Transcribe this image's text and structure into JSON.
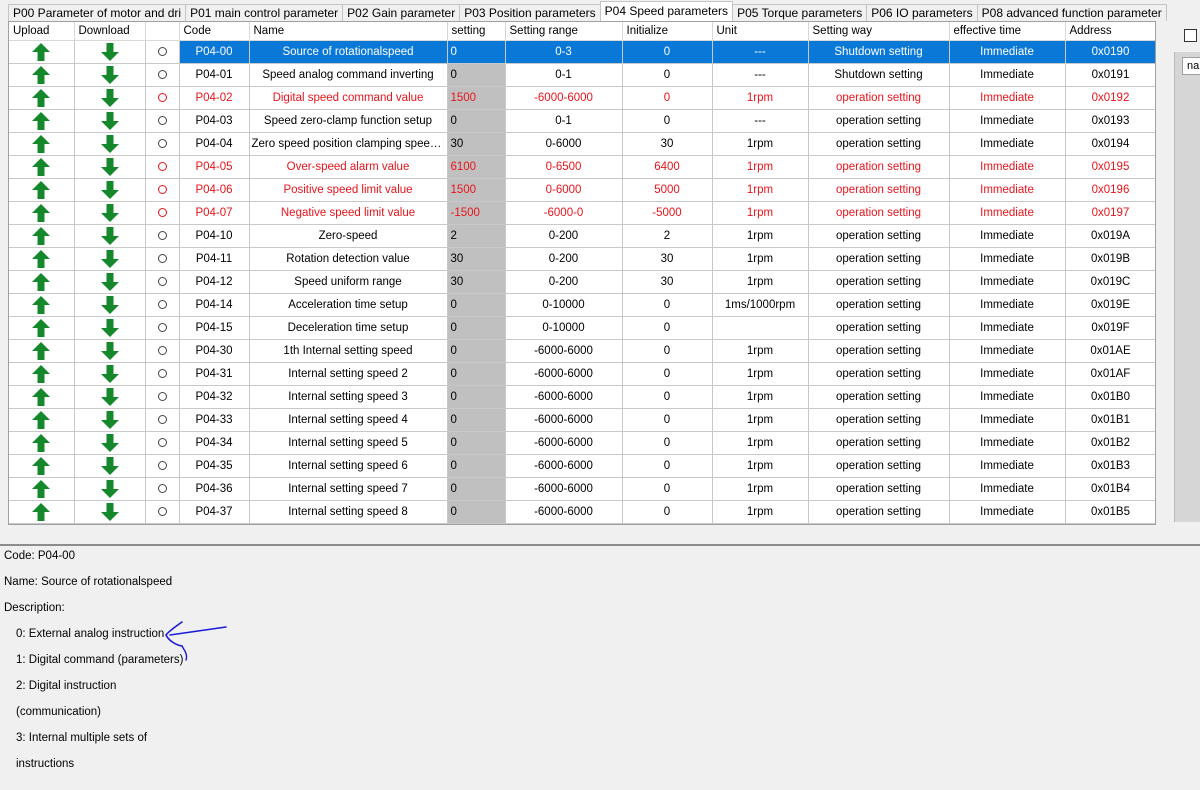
{
  "tabs": [
    {
      "label": "P00  Parameter of motor and dri",
      "active": false
    },
    {
      "label": "P01 main control parameter",
      "active": false
    },
    {
      "label": "P02 Gain parameter",
      "active": false
    },
    {
      "label": "P03 Position parameters",
      "active": false
    },
    {
      "label": "P04 Speed parameters",
      "active": true
    },
    {
      "label": "P05 Torque parameters",
      "active": false
    },
    {
      "label": "P06 IO parameters",
      "active": false
    },
    {
      "label": "P08 advanced function parameter",
      "active": false
    }
  ],
  "columns": [
    "Upload",
    "Download",
    "",
    "Code",
    "Name",
    "setting",
    "Setting range",
    "Initialize",
    "Unit",
    "Setting way",
    "effective time",
    "Address"
  ],
  "rows": [
    {
      "code": "P04-00",
      "name": "Source of rotationalspeed",
      "setting": "0",
      "range": "0-3",
      "init": "0",
      "unit": "---",
      "way": "Shutdown setting",
      "time": "Immediate",
      "addr": "0x0190",
      "state": "selected"
    },
    {
      "code": "P04-01",
      "name": "Speed analog command inverting",
      "setting": "0",
      "range": "0-1",
      "init": "0",
      "unit": "---",
      "way": "Shutdown setting",
      "time": "Immediate",
      "addr": "0x0191",
      "state": "normal"
    },
    {
      "code": "P04-02",
      "name": "Digital speed command value",
      "setting": "1500",
      "range": "-6000-6000",
      "init": "0",
      "unit": "1rpm",
      "way": "operation setting",
      "time": "Immediate",
      "addr": "0x0192",
      "state": "modified"
    },
    {
      "code": "P04-03",
      "name": "Speed zero-clamp function setup",
      "setting": "0",
      "range": "0-1",
      "init": "0",
      "unit": "---",
      "way": "operation setting",
      "time": "Immediate",
      "addr": "0x0193",
      "state": "normal"
    },
    {
      "code": "P04-04",
      "name": "Zero speed position clamping speed threshold",
      "setting": "30",
      "range": "0-6000",
      "init": "30",
      "unit": "1rpm",
      "way": "operation setting",
      "time": "Immediate",
      "addr": "0x0194",
      "state": "normal"
    },
    {
      "code": "P04-05",
      "name": "Over-speed alarm value",
      "setting": "6100",
      "range": "0-6500",
      "init": "6400",
      "unit": "1rpm",
      "way": "operation setting",
      "time": "Immediate",
      "addr": "0x0195",
      "state": "modified"
    },
    {
      "code": "P04-06",
      "name": "Positive speed limit value",
      "setting": "1500",
      "range": "0-6000",
      "init": "5000",
      "unit": "1rpm",
      "way": "operation setting",
      "time": "Immediate",
      "addr": "0x0196",
      "state": "modified"
    },
    {
      "code": "P04-07",
      "name": "Negative speed limit value",
      "setting": "-1500",
      "range": "-6000-0",
      "init": "-5000",
      "unit": "1rpm",
      "way": "operation setting",
      "time": "Immediate",
      "addr": "0x0197",
      "state": "modified"
    },
    {
      "code": "P04-10",
      "name": "Zero-speed",
      "setting": "2",
      "range": "0-200",
      "init": "2",
      "unit": "1rpm",
      "way": "operation setting",
      "time": "Immediate",
      "addr": "0x019A",
      "state": "normal"
    },
    {
      "code": "P04-11",
      "name": "Rotation detection value",
      "setting": "30",
      "range": "0-200",
      "init": "30",
      "unit": "1rpm",
      "way": "operation setting",
      "time": "Immediate",
      "addr": "0x019B",
      "state": "normal"
    },
    {
      "code": "P04-12",
      "name": "Speed uniform range",
      "setting": "30",
      "range": "0-200",
      "init": "30",
      "unit": "1rpm",
      "way": "operation setting",
      "time": "Immediate",
      "addr": "0x019C",
      "state": "normal"
    },
    {
      "code": "P04-14",
      "name": "Acceleration time setup",
      "setting": "0",
      "range": "0-10000",
      "init": "0",
      "unit": "1ms/1000rpm",
      "way": "operation setting",
      "time": "Immediate",
      "addr": "0x019E",
      "state": "normal"
    },
    {
      "code": "P04-15",
      "name": "Deceleration time setup",
      "setting": "0",
      "range": "0-10000",
      "init": "0",
      "unit": "",
      "way": "operation setting",
      "time": "Immediate",
      "addr": "0x019F",
      "state": "normal"
    },
    {
      "code": "P04-30",
      "name": "1th Internal setting speed",
      "setting": "0",
      "range": "-6000-6000",
      "init": "0",
      "unit": "1rpm",
      "way": "operation setting",
      "time": "Immediate",
      "addr": "0x01AE",
      "state": "normal"
    },
    {
      "code": "P04-31",
      "name": "Internal setting speed 2",
      "setting": "0",
      "range": "-6000-6000",
      "init": "0",
      "unit": "1rpm",
      "way": "operation setting",
      "time": "Immediate",
      "addr": "0x01AF",
      "state": "normal"
    },
    {
      "code": "P04-32",
      "name": "Internal setting speed 3",
      "setting": "0",
      "range": "-6000-6000",
      "init": "0",
      "unit": "1rpm",
      "way": "operation setting",
      "time": "Immediate",
      "addr": "0x01B0",
      "state": "normal"
    },
    {
      "code": "P04-33",
      "name": "Internal setting speed 4",
      "setting": "0",
      "range": "-6000-6000",
      "init": "0",
      "unit": "1rpm",
      "way": "operation setting",
      "time": "Immediate",
      "addr": "0x01B1",
      "state": "normal"
    },
    {
      "code": "P04-34",
      "name": "Internal setting speed 5",
      "setting": "0",
      "range": "-6000-6000",
      "init": "0",
      "unit": "1rpm",
      "way": "operation setting",
      "time": "Immediate",
      "addr": "0x01B2",
      "state": "normal"
    },
    {
      "code": "P04-35",
      "name": "Internal setting speed 6",
      "setting": "0",
      "range": "-6000-6000",
      "init": "0",
      "unit": "1rpm",
      "way": "operation setting",
      "time": "Immediate",
      "addr": "0x01B3",
      "state": "normal"
    },
    {
      "code": "P04-36",
      "name": "Internal setting speed 7",
      "setting": "0",
      "range": "-6000-6000",
      "init": "0",
      "unit": "1rpm",
      "way": "operation setting",
      "time": "Immediate",
      "addr": "0x01B4",
      "state": "normal"
    },
    {
      "code": "P04-37",
      "name": "Internal setting speed 8",
      "setting": "0",
      "range": "-6000-6000",
      "init": "0",
      "unit": "1rpm",
      "way": "operation setting",
      "time": "Immediate",
      "addr": "0x01B5",
      "state": "normal"
    }
  ],
  "colors": {
    "upload_arrow": "#15882b",
    "download_arrow": "#15882b",
    "selected_row": "#0a78d7",
    "modified_text": "#e8141c",
    "setting_cell": "#c0c0c0",
    "annotation": "#1a1ad8"
  },
  "icons": {
    "upload": "up-arrow-icon",
    "download": "down-arrow-icon",
    "select": "radio-circle-icon"
  },
  "right_panel": {
    "input_text": "na"
  },
  "description": {
    "code_line": "Code: P04-00",
    "name_line": "Name: Source of rotationalspeed",
    "desc_label": "Description:",
    "lines": [
      "0: External analog instruction",
      "1: Digital command (parameters)",
      "2: Digital instruction",
      "(communication)",
      "3: Internal multiple sets of",
      "instructions"
    ]
  }
}
